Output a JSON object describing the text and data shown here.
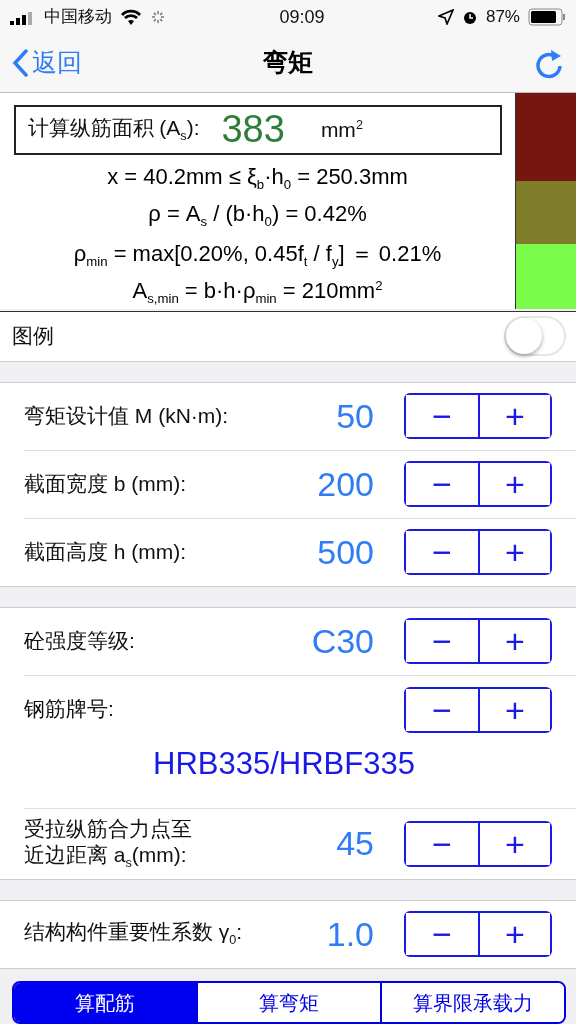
{
  "status_bar": {
    "carrier": "中国移动",
    "time": "09:09",
    "battery": "87%"
  },
  "nav": {
    "back": "返回",
    "title": "弯矩"
  },
  "result": {
    "label": "计算纵筋面积 (A$_{s}$):",
    "value": "383",
    "unit": "mm$^{2}$",
    "lines": [
      "x = 40.2mm  ≤  ξ$_{b}$·h$_{0}$ = 250.3mm",
      "ρ = A$_{s}$ / (b·h$_{0}$) = 0.42%",
      "ρ$_{min}$ = max[0.20%, 0.45f$_{t}$ / f$_{y}$] ＝ 0.21%",
      "A$_{s,min}$ = b·h·ρ$_{min}$ = 210mm$^{2}$"
    ]
  },
  "color_scale": [
    {
      "color": "#761610"
    },
    {
      "color": "#7f7d2a"
    },
    {
      "color": "#7cfc4a"
    }
  ],
  "legend": {
    "label": "图例",
    "on": false
  },
  "groups": [
    {
      "rows": [
        {
          "kind": "inline",
          "label": "弯矩设计值  M (kN·m):",
          "value": "50",
          "minus": "−",
          "plus": "+"
        },
        {
          "kind": "inline",
          "label": "截面宽度  b (mm):",
          "value": "200",
          "minus": "−",
          "plus": "+"
        },
        {
          "kind": "inline",
          "label": "截面高度  h (mm):",
          "value": "500",
          "minus": "−",
          "plus": "+"
        }
      ]
    },
    {
      "rows": [
        {
          "kind": "inline",
          "label": "砼强度等级:",
          "value": "C30",
          "minus": "−",
          "plus": "+"
        },
        {
          "kind": "below",
          "label": "钢筋牌号:",
          "value": "HRB335/HRBF335",
          "minus": "−",
          "plus": "+"
        },
        {
          "kind": "inline",
          "label_lines": [
            "受拉纵筋合力点至",
            "近边距离  a$_{s}$(mm):"
          ],
          "value": "45",
          "minus": "−",
          "plus": "+"
        }
      ]
    },
    {
      "rows": [
        {
          "kind": "inline",
          "label": "结构构件重要性系数  γ$_{0}$:",
          "value": "1.0",
          "minus": "−",
          "plus": "+"
        }
      ]
    }
  ],
  "modes": [
    {
      "label": "算配筋",
      "selected": true
    },
    {
      "label": "算弯矩",
      "selected": false
    },
    {
      "label": "算界限承载力",
      "selected": false
    }
  ]
}
